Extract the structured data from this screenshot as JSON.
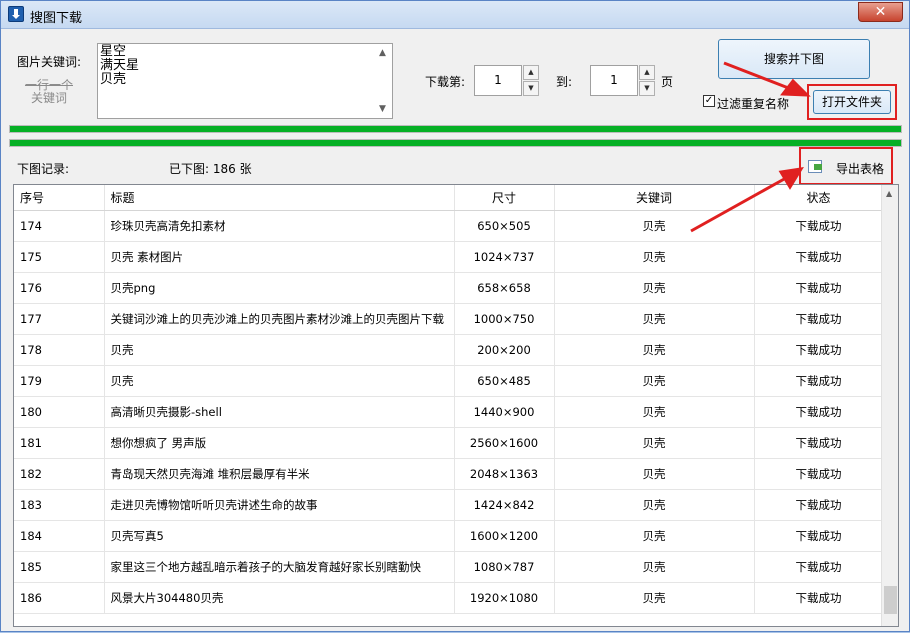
{
  "window": {
    "title": "搜图下载",
    "close_glyph": "✕"
  },
  "keywords": {
    "label": "图片关键词:",
    "hint_line1": "一行一个",
    "hint_line2": "关键词",
    "lines": [
      "星空",
      "满天星",
      "贝壳"
    ]
  },
  "range": {
    "from_label": "下载第:",
    "from_value": "1",
    "to_label": "到:",
    "to_value": "1",
    "page_label": "页"
  },
  "actions": {
    "search_label": "搜索并下图",
    "filter_label": "过滤重复名称",
    "filter_checked": true,
    "open_folder_label": "打开文件夹",
    "export_label": "导出表格"
  },
  "progress": {
    "bar1": 1.0,
    "bar2": 1.0
  },
  "records": {
    "label": "下图记录:",
    "count_label": "已下图:  186 张"
  },
  "table": {
    "headers": [
      "序号",
      "标题",
      "尺寸",
      "关键词",
      "状态"
    ],
    "rows": [
      [
        "174",
        "珍珠贝壳高清免扣素材",
        "650×505",
        "贝壳",
        "下载成功"
      ],
      [
        "175",
        "贝壳 素材图片",
        "1024×737",
        "贝壳",
        "下载成功"
      ],
      [
        "176",
        "贝壳png",
        "658×658",
        "贝壳",
        "下载成功"
      ],
      [
        "177",
        "关键词沙滩上的贝壳沙滩上的贝壳图片素材沙滩上的贝壳图片下载",
        "1000×750",
        "贝壳",
        "下载成功"
      ],
      [
        "178",
        "贝壳",
        "200×200",
        "贝壳",
        "下载成功"
      ],
      [
        "179",
        "贝壳",
        "650×485",
        "贝壳",
        "下载成功"
      ],
      [
        "180",
        "高清晰贝壳摄影-shell",
        "1440×900",
        "贝壳",
        "下载成功"
      ],
      [
        "181",
        "想你想疯了 男声版",
        "2560×1600",
        "贝壳",
        "下载成功"
      ],
      [
        "182",
        "青岛现天然贝壳海滩 堆积层最厚有半米",
        "2048×1363",
        "贝壳",
        "下载成功"
      ],
      [
        "183",
        "走进贝壳博物馆听听贝壳讲述生命的故事",
        "1424×842",
        "贝壳",
        "下载成功"
      ],
      [
        "184",
        "贝壳写真5",
        "1600×1200",
        "贝壳",
        "下载成功"
      ],
      [
        "185",
        "家里这三个地方越乱暗示着孩子的大脑发育越好家长别瞎勤快",
        "1080×787",
        "贝壳",
        "下载成功"
      ],
      [
        "186",
        "风景大片304480贝壳",
        "1920×1080",
        "贝壳",
        "下载成功"
      ]
    ]
  },
  "colors": {
    "progress_green": "#06b025",
    "highlight_red": "#e02020"
  }
}
